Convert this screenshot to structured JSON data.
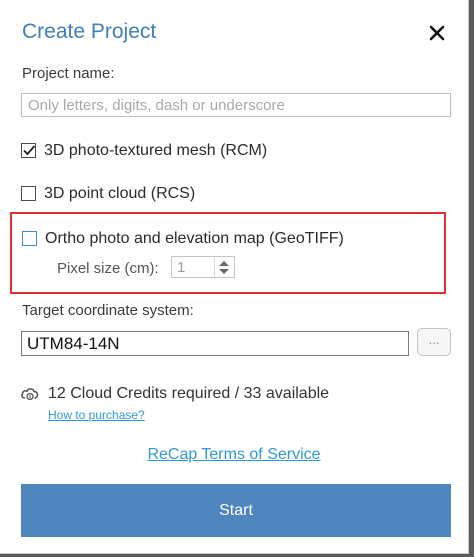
{
  "dialog": {
    "title": "Create Project",
    "close_icon": "close-icon"
  },
  "project_name": {
    "label": "Project name:",
    "placeholder": "Only letters, digits, dash or underscore",
    "value": ""
  },
  "outputs": [
    {
      "label": "3D photo-textured mesh (RCM)",
      "checked": true
    },
    {
      "label": "3D point cloud (RCS)",
      "checked": false
    },
    {
      "label": "Ortho photo and elevation map (GeoTIFF)",
      "checked": false
    }
  ],
  "pixel_size": {
    "label": "Pixel size (cm):",
    "value": "1"
  },
  "coordinate_system": {
    "label": "Target coordinate system:",
    "value": "UTM84-14N",
    "browse_label": "..."
  },
  "credits": {
    "icon": "cloud-credits-icon",
    "text": "12 Cloud Credits required / 33 available",
    "purchase_link": "How to purchase?"
  },
  "terms_link": "ReCap Terms of Service",
  "start_button": "Start",
  "colors": {
    "title": "#3f7fba",
    "link": "#2f9ad6",
    "highlight_border": "#e1302f",
    "start_button": "#4f86bd"
  }
}
